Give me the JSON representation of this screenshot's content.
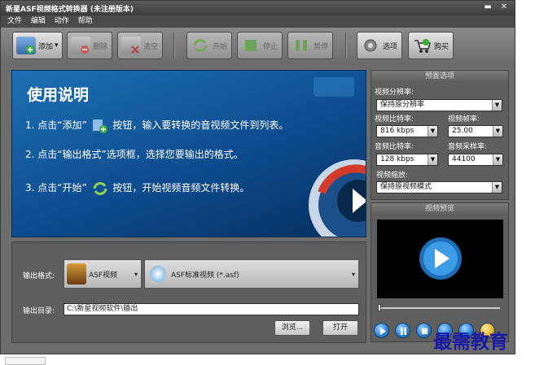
{
  "window": {
    "title": "新星ASF视频格式转换器 (未注册版本)",
    "min_glyph": "▬",
    "close_glyph": "✕"
  },
  "menu": [
    "文件",
    "编辑",
    "动作",
    "帮助"
  ],
  "toolbar": {
    "add": "添加",
    "add_arrow": "▾",
    "delete": "删除",
    "clear": "清空",
    "start": "开始",
    "stop": "停止",
    "pause": "暂停",
    "options": "选项",
    "buy": "购买"
  },
  "banner": {
    "title": "使用说明",
    "step1a": "1. 点击“添加”",
    "step1b": "按钮，输入要转换的音视频文件到列表。",
    "step2": "2. 点击“输出格式”选项框，选择您要输出的格式。",
    "step3a": "3. 点击“开始”",
    "step3b": "按钮，开始视频音频文件转换。"
  },
  "output": {
    "format_label": "输出格式:",
    "format_category": "ASF视频",
    "format_profile": "ASF标准视频 (*.asf)",
    "dir_label": "输出目录:",
    "dir_value": "C:\\新星视频软件\\输出",
    "browse": "浏览...",
    "open": "打开"
  },
  "preset": {
    "header": "预置选项",
    "resolution_label": "视频分辨率:",
    "resolution": "保持原分辨率",
    "vbitrate_label": "视频比特率:",
    "vbitrate": "816 kbps",
    "fps_label": "视频帧率:",
    "fps": "25.00",
    "abitrate_label": "音频比特率:",
    "abitrate": "128 kbps",
    "samplerate_label": "音频采样率:",
    "samplerate": "44100",
    "scale_label": "视频缩放:",
    "scale": "保持原视频模式"
  },
  "preview": {
    "header": "视频预览"
  },
  "watermark": "最需教育",
  "colors": {
    "banner": "#0d4c8f",
    "window": "#6c6c6c",
    "play": "#2a7fcf"
  }
}
